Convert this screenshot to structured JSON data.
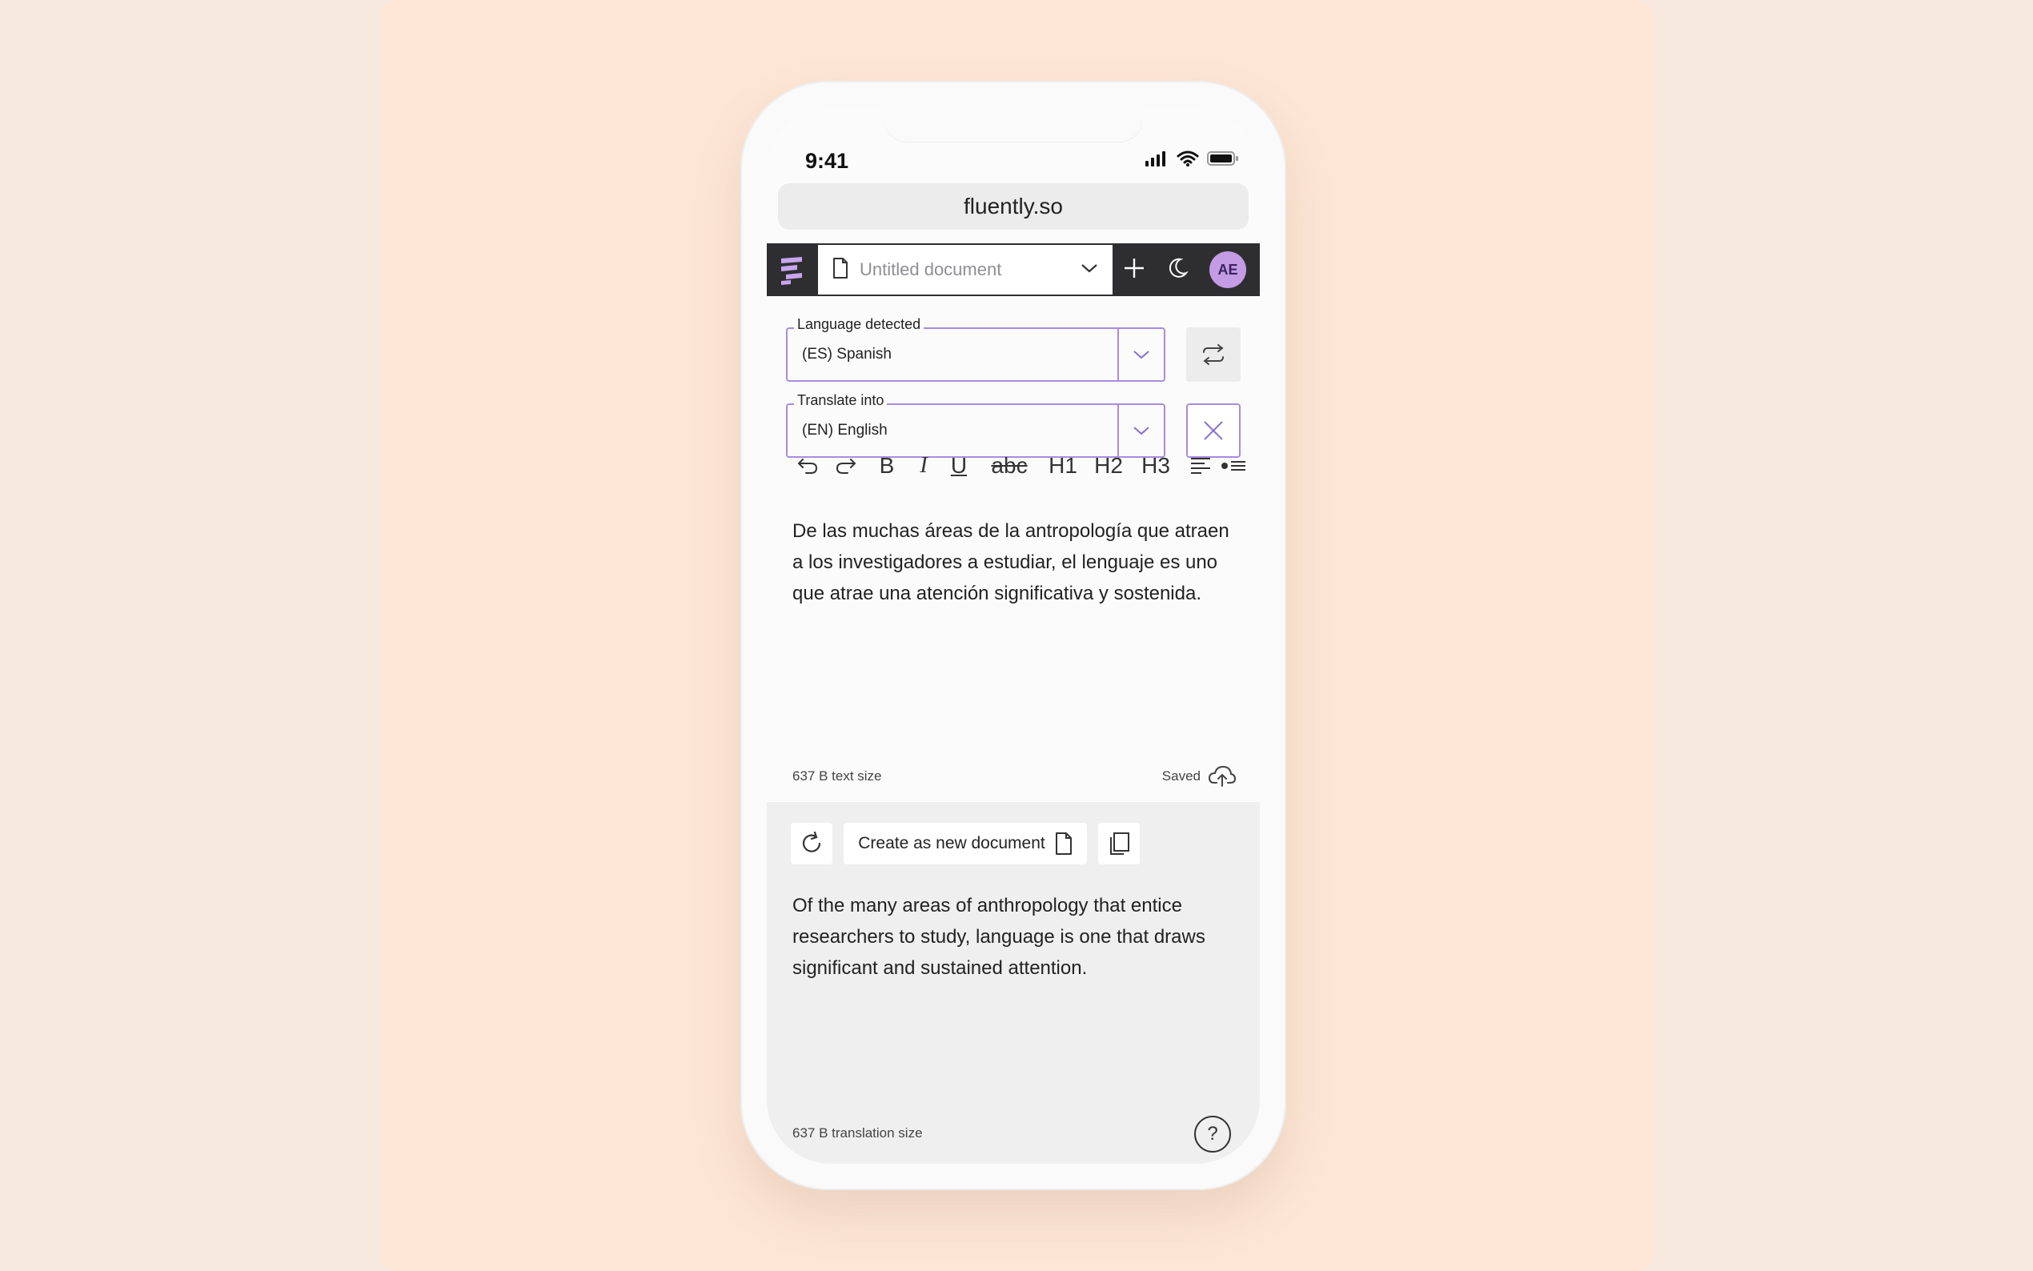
{
  "status": {
    "time": "9:41"
  },
  "browser": {
    "url": "fluently.so"
  },
  "appbar": {
    "doc_title": "Untitled document",
    "avatar_initials": "AE",
    "accent": "#a98ae0"
  },
  "source_lang": {
    "label": "Language detected",
    "value": "(ES)  Spanish"
  },
  "target_lang": {
    "label": "Translate into",
    "value": "(EN)  English"
  },
  "toolbar": {
    "bold": "B",
    "italic": "I",
    "underline": "U",
    "strike": "abc",
    "h1": "H1",
    "h2": "H2",
    "h3": "H3"
  },
  "editor": {
    "source_text": "De las muchas áreas de la antropología que atraen a los investigadores a estudiar, el lenguaje es uno que atrae una atención significativa y sostenida.",
    "text_size": "637 B text size",
    "saved_label": "Saved"
  },
  "translation": {
    "create_label": "Create as new document",
    "text": "Of the many areas of anthropology that entice researchers to study, language is one that draws significant and sustained attention.",
    "size": "637 B translation size",
    "help": "?"
  }
}
